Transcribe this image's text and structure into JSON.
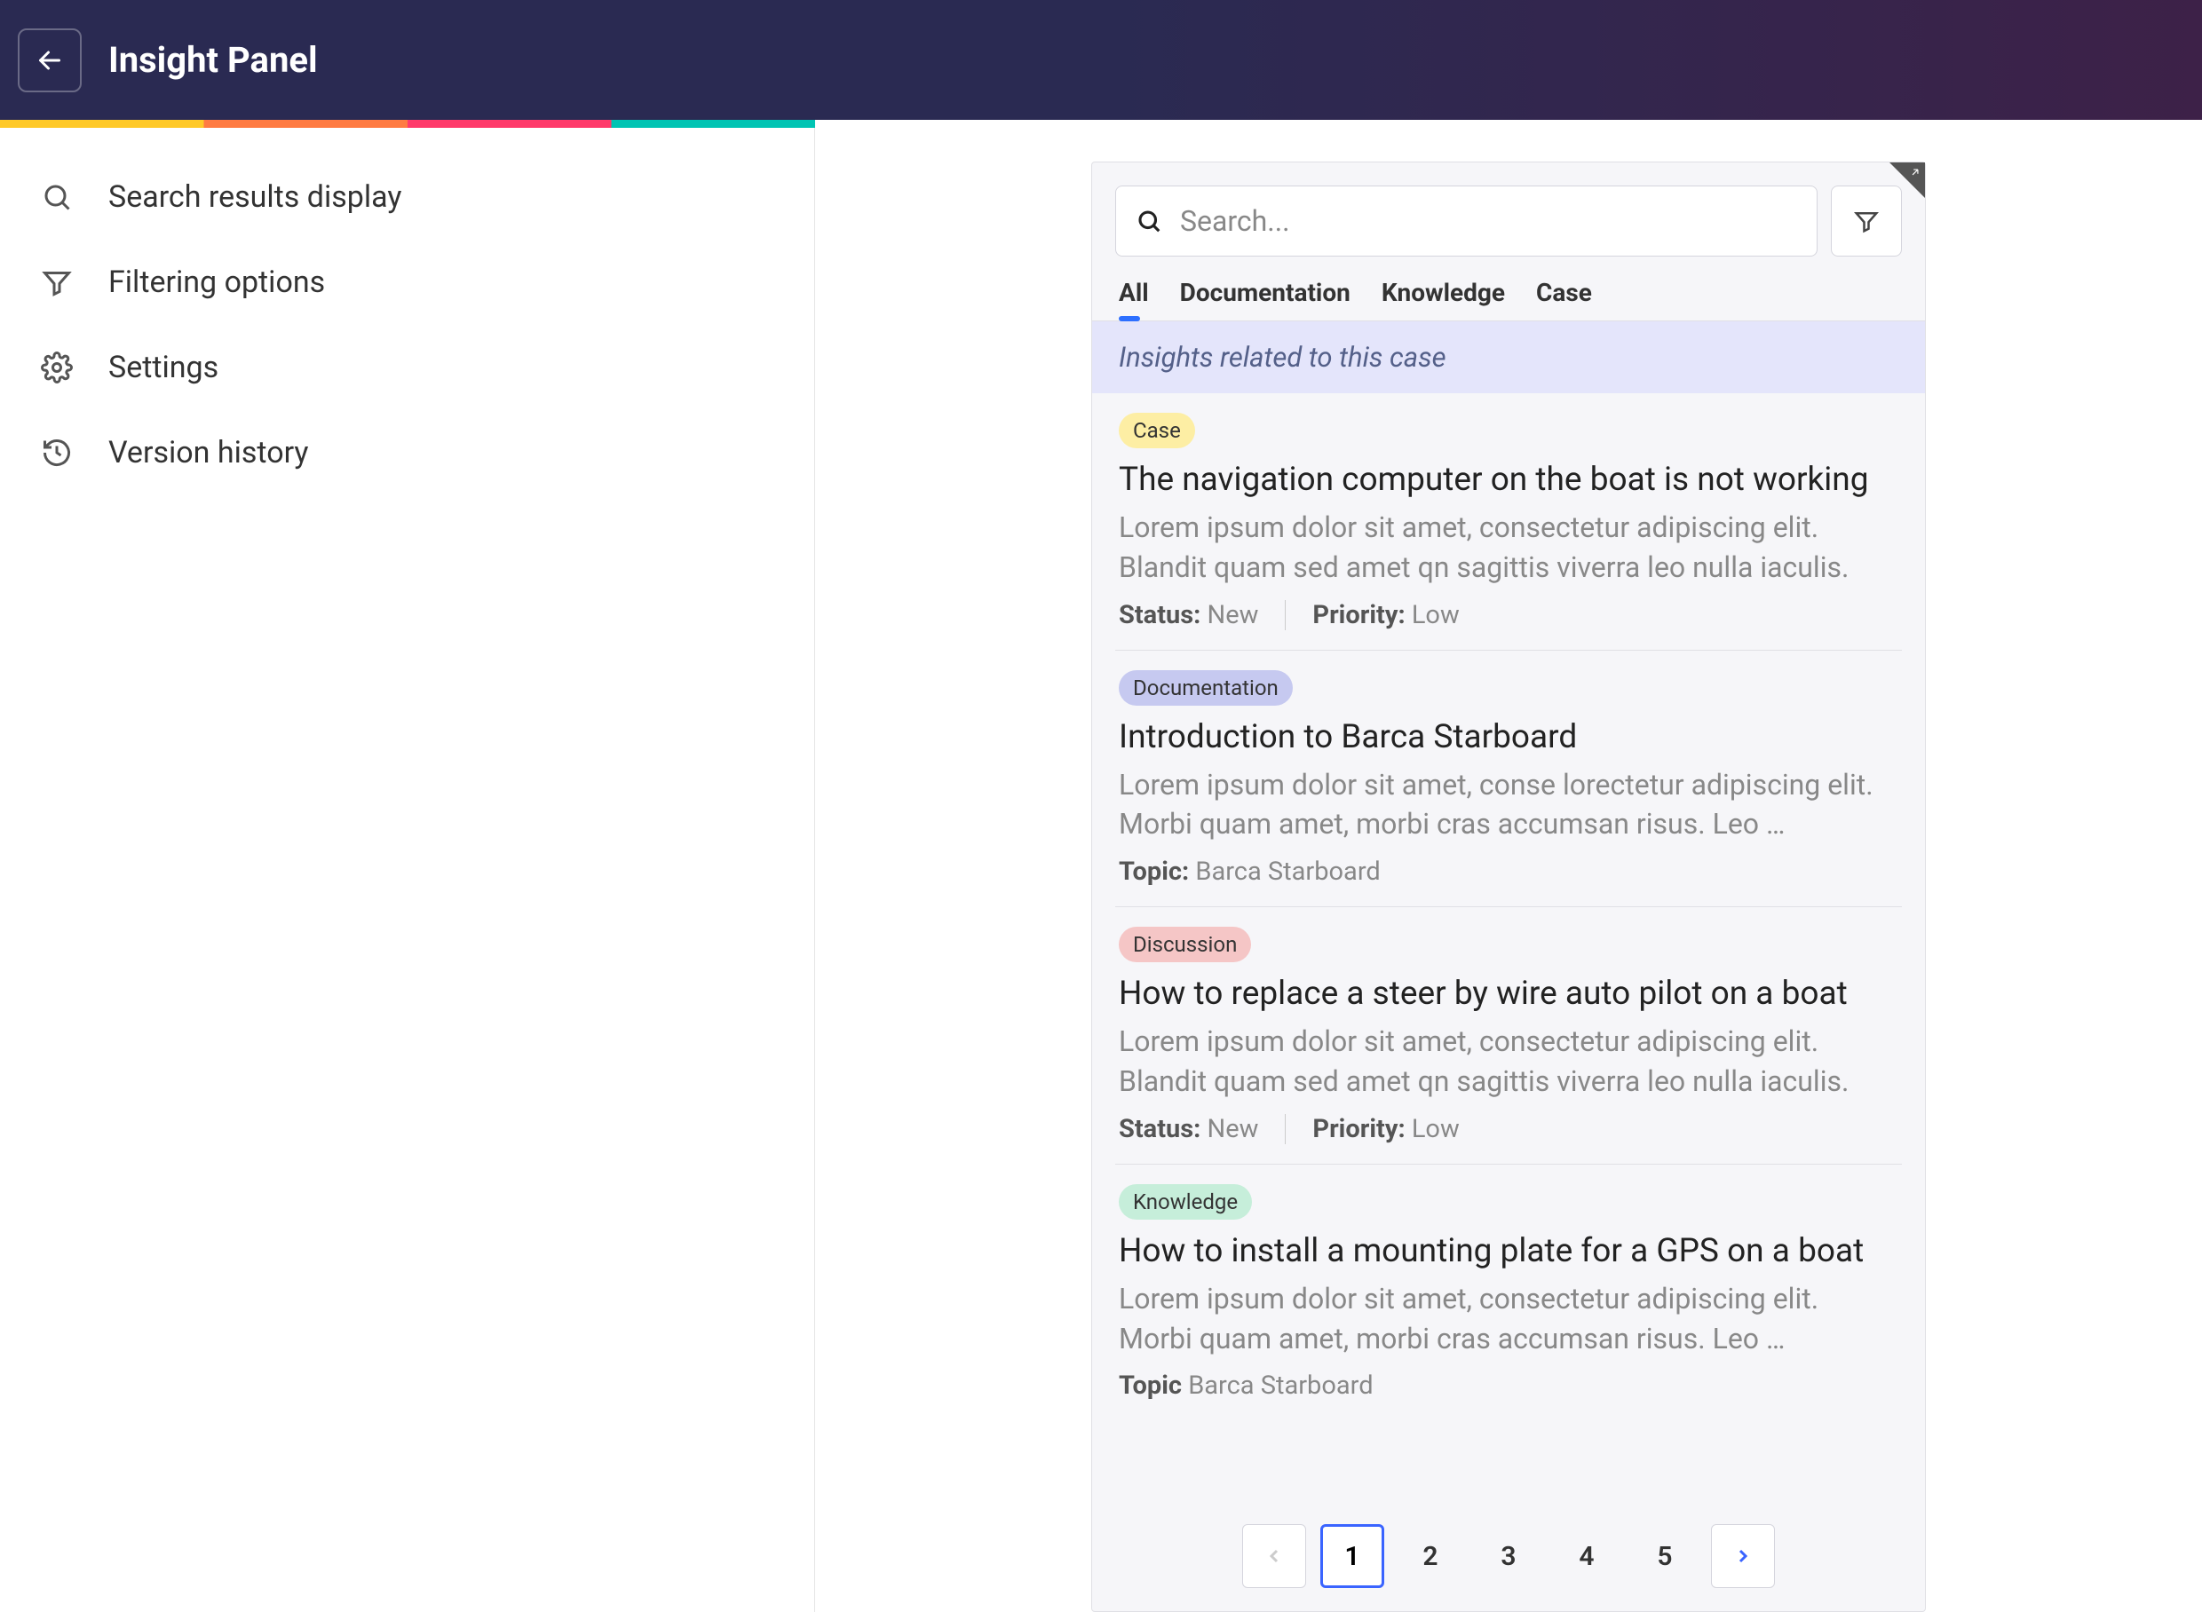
{
  "header": {
    "title": "Insight Panel"
  },
  "sidebar": {
    "items": [
      {
        "icon": "search",
        "label": "Search results display"
      },
      {
        "icon": "filter",
        "label": "Filtering options"
      },
      {
        "icon": "settings",
        "label": "Settings"
      },
      {
        "icon": "history",
        "label": "Version history"
      }
    ]
  },
  "panel": {
    "search_placeholder": "Search...",
    "tabs": [
      "All",
      "Documentation",
      "Knowledge",
      "Case"
    ],
    "active_tab": 0,
    "banner": "Insights related to this case",
    "results": [
      {
        "badge": "Case",
        "badge_class": "case",
        "title": "The navigation computer on the boat is not working",
        "desc": "Lorem ipsum dolor sit amet, consectetur adipiscing elit. Blandit quam sed amet qn sagittis viverra leo nulla iaculis.",
        "meta": [
          {
            "label": "Status:",
            "value": "New"
          },
          {
            "label": "Priority:",
            "value": "Low"
          }
        ]
      },
      {
        "badge": "Documentation",
        "badge_class": "documentation",
        "title": "Introduction to Barca Starboard",
        "desc": "Lorem ipsum dolor sit amet, conse  lorectetur adipiscing elit. Morbi quam amet, morbi cras accumsan risus. Leo …",
        "meta": [
          {
            "label": "Topic:",
            "value": "Barca Starboard"
          }
        ]
      },
      {
        "badge": "Discussion",
        "badge_class": "discussion",
        "title": "How to replace a steer by wire auto pilot on a boat",
        "desc": "Lorem ipsum dolor sit amet, consectetur adipiscing elit. Blandit quam sed amet qn sagittis viverra leo nulla iaculis.",
        "meta": [
          {
            "label": "Status:",
            "value": "New"
          },
          {
            "label": "Priority:",
            "value": "Low"
          }
        ]
      },
      {
        "badge": "Knowledge",
        "badge_class": "knowledge",
        "title": "How to install a mounting plate for a GPS on a boat",
        "desc": "Lorem ipsum dolor sit amet, consectetur adipiscing elit. Morbi quam amet, morbi cras accumsan risus. Leo …",
        "meta": [
          {
            "label": "Topic",
            "value": "Barca Starboard"
          }
        ]
      }
    ],
    "pagination": {
      "pages": [
        "1",
        "2",
        "3",
        "4",
        "5"
      ],
      "active": 0
    }
  }
}
